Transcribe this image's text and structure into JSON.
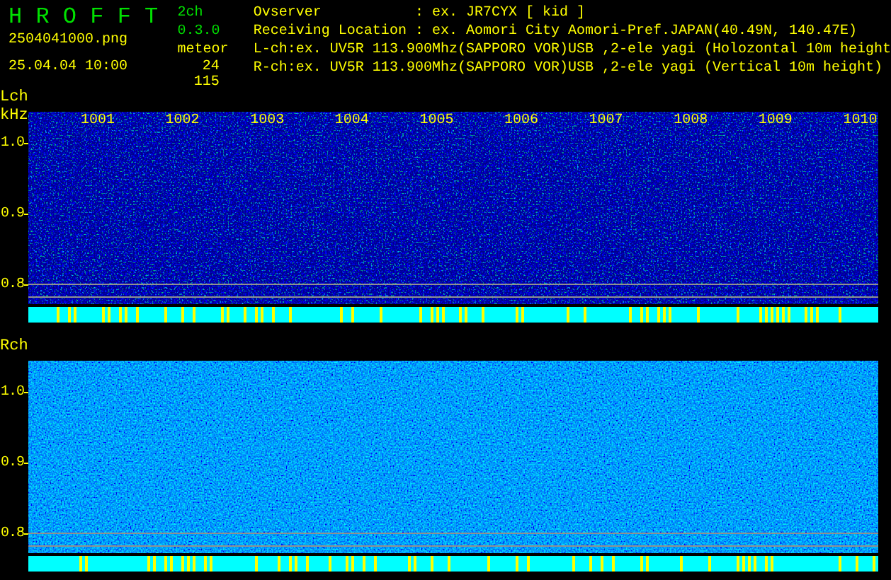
{
  "header": {
    "app_title": "H R O F F T",
    "version": "2ch 0.3.0",
    "file_name": "2504041000.png",
    "timestamp": "25.04.04 10:00",
    "meteor_label": "meteor",
    "meteor_counts": [
      "24",
      "115"
    ],
    "info_lines": [
      "Ovserver           : ex. JR7CYX [ kid ]",
      "Receiving Location : ex. Aomori City Aomori-Pref.JAPAN(40.49N, 140.47E)",
      "L-ch:ex. UV5R 113.900Mhz(SAPPORO VOR)USB ,2-ele yagi (Holozontal 10m height",
      "R-ch:ex. UV5R 113.900Mhz(SAPPORO VOR)USB ,2-ele yagi (Vertical 10m height)"
    ]
  },
  "channels": [
    {
      "label": "Lch",
      "unit": "kHz",
      "minute_labels": [
        "1001",
        "1002",
        "1003",
        "1004",
        "1005",
        "1006",
        "1007",
        "1008",
        "1009",
        "1010"
      ],
      "y_ticks": [
        "1.0",
        "0.9",
        "0.8"
      ]
    },
    {
      "label": "Rch",
      "y_ticks": [
        "1.0",
        "0.9",
        "0.8"
      ]
    }
  ]
}
